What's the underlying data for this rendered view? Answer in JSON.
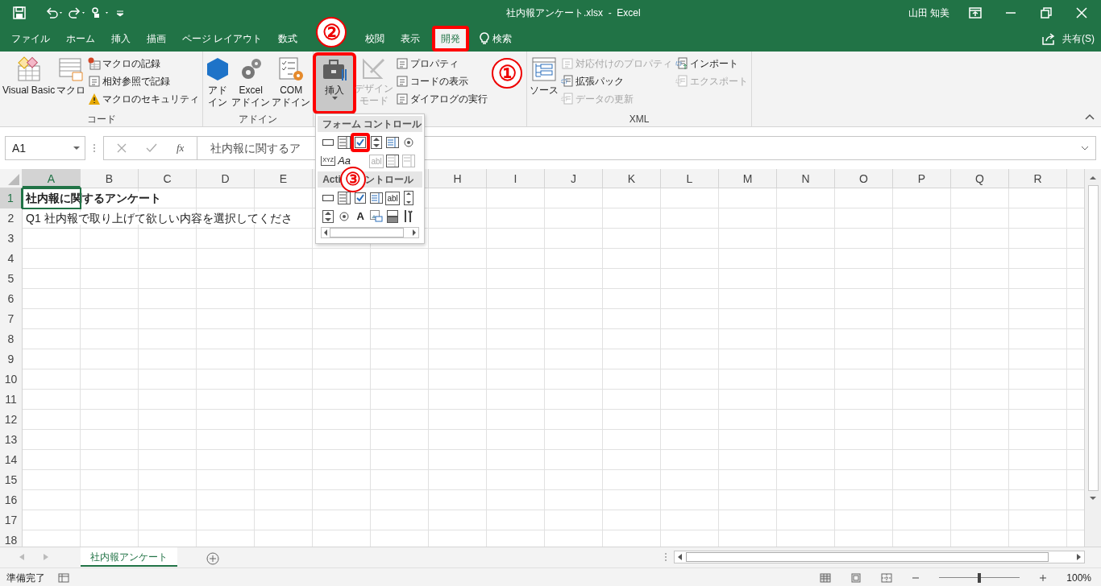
{
  "title_bar": {
    "title": "社内報アンケート.xlsx  -  Excel",
    "user": "山田 知美"
  },
  "ribbon_tabs": [
    {
      "label": "ファイル",
      "selected": false,
      "highlighted": false
    },
    {
      "label": "ホーム",
      "selected": false,
      "highlighted": false
    },
    {
      "label": "挿入",
      "selected": false,
      "highlighted": false
    },
    {
      "label": "描画",
      "selected": false,
      "highlighted": false
    },
    {
      "label": "ページ レイアウト",
      "selected": false,
      "highlighted": false
    },
    {
      "label": "数式",
      "selected": false,
      "highlighted": false
    },
    {
      "label": "校閲",
      "selected": false,
      "highlighted": false
    },
    {
      "label": "表示",
      "selected": false,
      "highlighted": false
    },
    {
      "label": "開発",
      "selected": true,
      "highlighted": true
    }
  ],
  "search": {
    "label": "検索"
  },
  "share": {
    "label": "共有(S)"
  },
  "ribbon_groups": [
    {
      "label": "コード",
      "items": [
        {
          "kind": "large",
          "lines": [
            "Visual Basic"
          ],
          "disabled": false,
          "selected": false,
          "highlighted": false
        },
        {
          "kind": "large",
          "lines": [
            "マクロ"
          ],
          "disabled": false,
          "selected": false,
          "highlighted": false
        },
        {
          "kind": "stack",
          "entries": [
            {
              "label": "マクロの記録",
              "disabled": false
            },
            {
              "label": "相対参照で記録",
              "disabled": false
            },
            {
              "label": "マクロのセキュリティ",
              "disabled": false
            }
          ]
        }
      ]
    },
    {
      "label": "アドイン",
      "items": [
        {
          "kind": "large",
          "lines": [
            "アド",
            "イン"
          ],
          "disabled": false,
          "selected": false,
          "highlighted": false
        },
        {
          "kind": "large",
          "lines": [
            "Excel",
            "アドイン"
          ],
          "disabled": false,
          "selected": false,
          "highlighted": false
        },
        {
          "kind": "large",
          "lines": [
            "COM",
            "アドイン"
          ],
          "disabled": false,
          "selected": false,
          "highlighted": false
        }
      ]
    },
    {
      "items": [
        {
          "kind": "large",
          "lines": [
            "挿入"
          ],
          "disabled": false,
          "selected": true,
          "highlighted": true
        },
        {
          "kind": "large",
          "lines": [
            "デザイン",
            "モード"
          ],
          "disabled": true,
          "selected": false,
          "highlighted": false
        },
        {
          "kind": "stack",
          "entries": [
            {
              "label": "プロパティ",
              "disabled": false
            },
            {
              "label": "コードの表示",
              "disabled": false
            },
            {
              "label": "ダイアログの実行",
              "disabled": false
            }
          ]
        }
      ]
    },
    {
      "label": "XML",
      "items": [
        {
          "kind": "large",
          "lines": [
            "ソース"
          ],
          "disabled": false,
          "selected": false,
          "highlighted": false
        },
        {
          "kind": "stack",
          "entries": [
            {
              "label": "対応付けのプロパティ",
              "disabled": true
            },
            {
              "label": "拡張パック",
              "disabled": false
            },
            {
              "label": "データの更新",
              "disabled": true
            }
          ]
        },
        {
          "kind": "stack",
          "entries": [
            {
              "label": "インポート",
              "disabled": false
            },
            {
              "label": "エクスポート",
              "disabled": true
            }
          ]
        }
      ]
    }
  ],
  "formula_bar": {
    "name_box": "A1",
    "function_label": "fx",
    "formula": "社内報に関するア"
  },
  "columns": [
    {
      "label": "A",
      "selected": true
    },
    {
      "label": "B",
      "selected": false
    },
    {
      "label": "C",
      "selected": false
    },
    {
      "label": "D",
      "selected": false
    },
    {
      "label": "E",
      "selected": false
    },
    {
      "label": "H",
      "selected": false
    },
    {
      "label": "I",
      "selected": false
    },
    {
      "label": "J",
      "selected": false
    },
    {
      "label": "K",
      "selected": false
    },
    {
      "label": "L",
      "selected": false
    },
    {
      "label": "M",
      "selected": false
    },
    {
      "label": "N",
      "selected": false
    },
    {
      "label": "O",
      "selected": false
    },
    {
      "label": "P",
      "selected": false
    },
    {
      "label": "Q",
      "selected": false
    },
    {
      "label": "R",
      "selected": false
    }
  ],
  "rows": [
    {
      "number": "1",
      "selected": true,
      "cell_a": {
        "text": "社内報に関するアンケート",
        "bold": true
      }
    },
    {
      "number": "2",
      "selected": false,
      "cell_a": {
        "text": "Q1 社内報で取り上げて欲しい内容を選択してくださ",
        "bold": false
      }
    },
    {
      "number": "3",
      "selected": false
    },
    {
      "number": "4",
      "selected": false
    },
    {
      "number": "5",
      "selected": false
    },
    {
      "number": "6",
      "selected": false
    },
    {
      "number": "7",
      "selected": false
    },
    {
      "number": "8",
      "selected": false
    },
    {
      "number": "9",
      "selected": false
    },
    {
      "number": "10",
      "selected": false
    },
    {
      "number": "11",
      "selected": false
    },
    {
      "number": "12",
      "selected": false
    },
    {
      "number": "13",
      "selected": false
    },
    {
      "number": "14",
      "selected": false
    },
    {
      "number": "15",
      "selected": false
    },
    {
      "number": "16",
      "selected": false
    },
    {
      "number": "17",
      "selected": false
    },
    {
      "number": "18",
      "selected": false
    }
  ],
  "controls_menu": {
    "sections": [
      {
        "heading": [
          "フォーム コントロール"
        ],
        "items": [
          {
            "kind": "button",
            "highlighted": false
          },
          {
            "kind": "combo",
            "highlighted": false
          },
          {
            "kind": "checkbox",
            "highlighted": true
          },
          {
            "kind": "spin",
            "highlighted": false
          },
          {
            "kind": "list",
            "highlighted": false
          },
          {
            "kind": "radio",
            "highlighted": false
          },
          {
            "kind": "group",
            "text": "XYZ",
            "highlighted": false
          },
          {
            "kind": "label",
            "text": "Aa",
            "highlighted": false
          },
          {
            "kind": "hidden",
            "highlighted": false
          },
          {
            "kind": "textfield",
            "text": "abl",
            "highlighted": false
          },
          {
            "kind": "combolist",
            "highlighted": false
          },
          {
            "kind": "dropdown",
            "highlighted": false
          }
        ]
      },
      {
        "heading": [
          "Acti",
          "ントロール"
        ],
        "items": [
          {
            "kind": "button",
            "highlighted": false
          },
          {
            "kind": "combo",
            "highlighted": false
          },
          {
            "kind": "checkbox",
            "highlighted": false
          },
          {
            "kind": "list",
            "highlighted": false
          },
          {
            "kind": "textbox",
            "text": "abl",
            "highlighted": false
          },
          {
            "kind": "scroll",
            "highlighted": false
          },
          {
            "kind": "spin",
            "highlighted": false
          },
          {
            "kind": "radio",
            "highlighted": false
          },
          {
            "kind": "label",
            "text": "A",
            "highlighted": false
          },
          {
            "kind": "image",
            "highlighted": false
          },
          {
            "kind": "toggle",
            "highlighted": false
          },
          {
            "kind": "tools",
            "highlighted": false
          }
        ]
      }
    ]
  },
  "callouts": [
    {
      "text": "①"
    },
    {
      "text": "②"
    },
    {
      "text": "③"
    }
  ],
  "sheet_tabs": [
    {
      "label": "社内報アンケート",
      "selected": true
    }
  ],
  "status_bar": {
    "status": "準備完了",
    "zoom": "100%",
    "zoom_slider": {
      "level": 0.5
    }
  }
}
